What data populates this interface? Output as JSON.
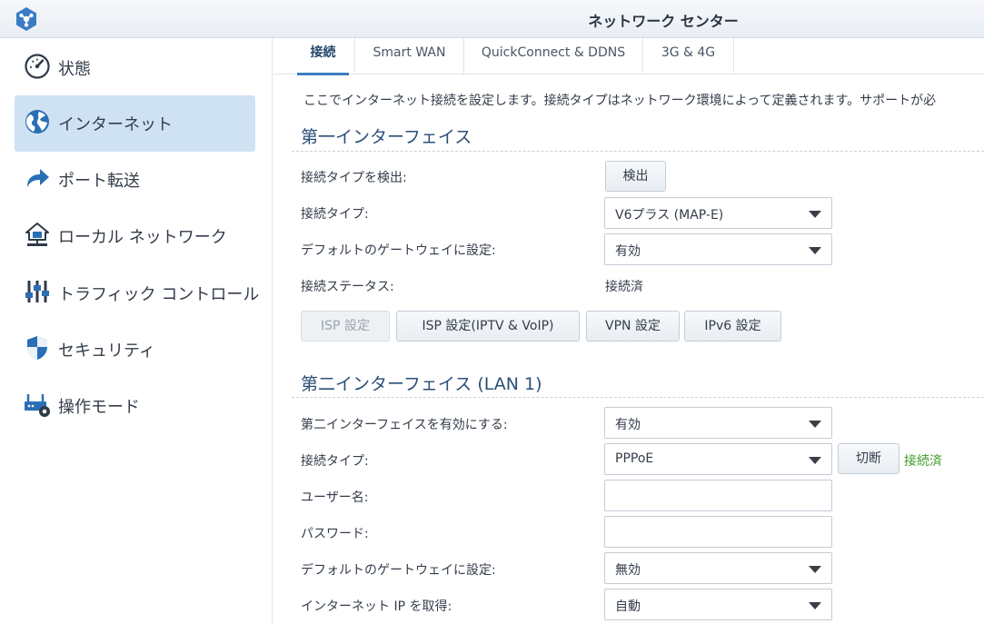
{
  "window": {
    "title": "ネットワーク センター"
  },
  "sidebar": {
    "items": [
      {
        "label": "状態",
        "icon": "gauge-icon",
        "active": false
      },
      {
        "label": "インターネット",
        "icon": "globe-icon",
        "active": true
      },
      {
        "label": "ポート転送",
        "icon": "arrow-forward-icon",
        "active": false
      },
      {
        "label": "ローカル ネットワーク",
        "icon": "home-network-icon",
        "active": false
      },
      {
        "label": "トラフィック コントロール",
        "icon": "sliders-icon",
        "active": false
      },
      {
        "label": "セキュリティ",
        "icon": "shield-icon",
        "active": false
      },
      {
        "label": "操作モード",
        "icon": "router-gear-icon",
        "active": false
      }
    ]
  },
  "tabs": [
    {
      "label": "接続",
      "active": true
    },
    {
      "label": "Smart WAN",
      "active": false
    },
    {
      "label": "QuickConnect & DDNS",
      "active": false
    },
    {
      "label": "3G & 4G",
      "active": false
    }
  ],
  "main": {
    "description": "ここでインターネット接続を設定します。接続タイプはネットワーク環境によって定義されます。サポートが必",
    "primary": {
      "title": "第一インターフェイス",
      "detect_label": "接続タイプを検出:",
      "detect_button": "検出",
      "type_label": "接続タイプ:",
      "type_value": "V6プラス (MAP-E)",
      "gateway_label": "デフォルトのゲートウェイに設定:",
      "gateway_value": "有効",
      "status_label": "接続ステータス:",
      "status_value": "接続済",
      "buttons": {
        "isp": "ISP 設定",
        "isp_iptv": "ISP 設定(IPTV & VoIP)",
        "vpn": "VPN 設定",
        "ipv6": "IPv6 設定"
      }
    },
    "secondary": {
      "title": "第二インターフェイス (LAN 1)",
      "enable_label": "第二インターフェイスを有効にする:",
      "enable_value": "有効",
      "type_label": "接続タイプ:",
      "type_value": "PPPoE",
      "disconnect_button": "切断",
      "connection_status": "接続済",
      "username_label": "ユーザー名:",
      "username_value": "",
      "password_label": "パスワード:",
      "password_value": "",
      "gateway_label": "デフォルトのゲートウェイに設定:",
      "gateway_value": "無効",
      "ip_label": "インターネット IP を取得:",
      "ip_value": "自動"
    }
  },
  "colors": {
    "accent": "#3d7ec1",
    "active_nav": "#cfe2f3",
    "section_title": "#2b4f78",
    "status_green": "#3c9a28"
  }
}
